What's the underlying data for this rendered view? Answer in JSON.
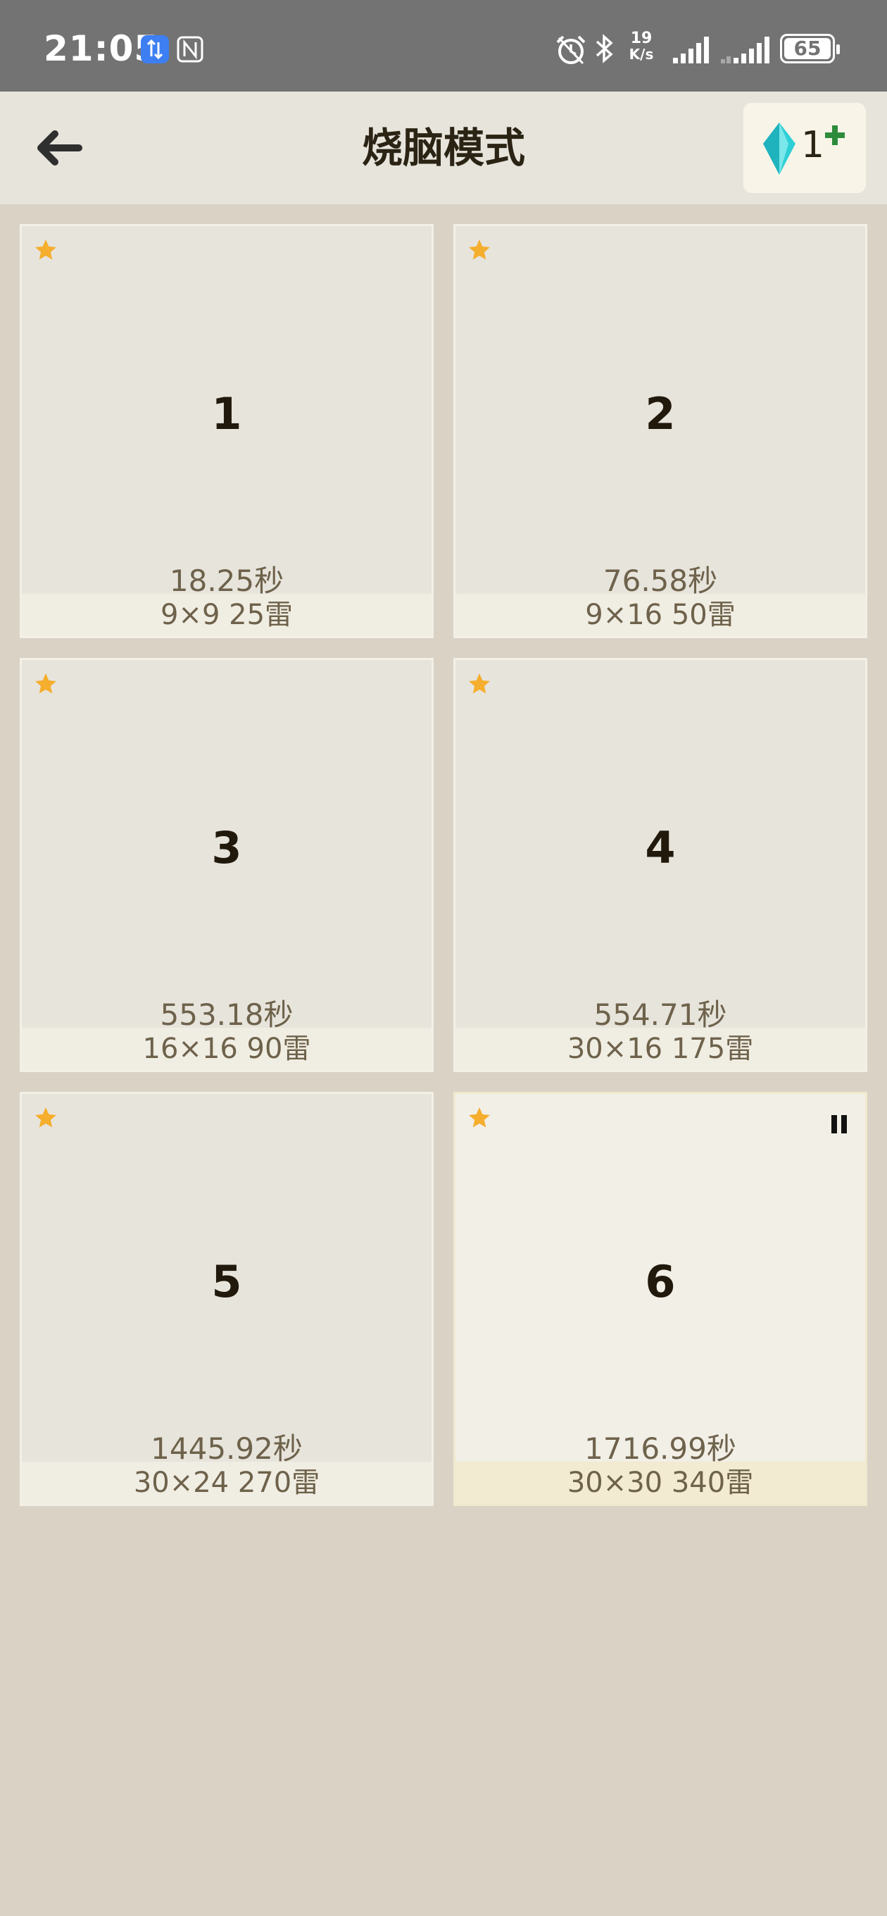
{
  "status_bar": {
    "time": "21:05",
    "net_speed_value": "19",
    "net_speed_unit": "K/s",
    "battery": "65"
  },
  "header": {
    "title": "烧脑模式",
    "gem_count": "1"
  },
  "colors": {
    "star": "#f5ae2d",
    "plus": "#2e8b3c",
    "gem": "#2fcfd6"
  },
  "levels": [
    {
      "number": "1",
      "time": "18.25秒",
      "info": "9×9  25雷"
    },
    {
      "number": "2",
      "time": "76.58秒",
      "info": "9×16  50雷"
    },
    {
      "number": "3",
      "time": "553.18秒",
      "info": "16×16  90雷"
    },
    {
      "number": "4",
      "time": "554.71秒",
      "info": "30×16  175雷"
    },
    {
      "number": "5",
      "time": "1445.92秒",
      "info": "30×24  270雷"
    },
    {
      "number": "6",
      "time": "1716.99秒",
      "info": "30×30  340雷"
    }
  ]
}
